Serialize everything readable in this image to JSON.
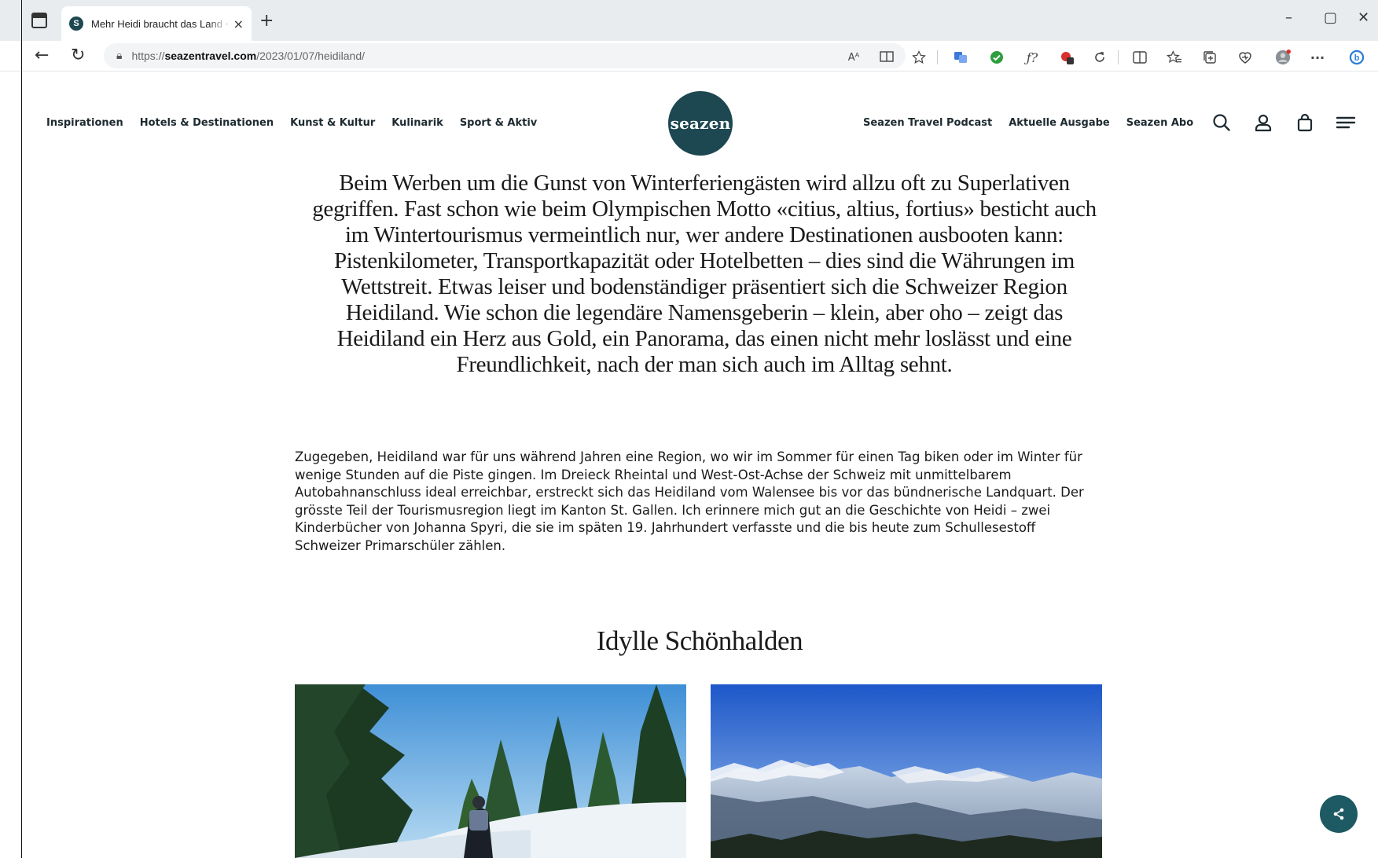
{
  "browser": {
    "tab_title": "Mehr Heidi braucht das Land • se",
    "favicon_letter": "S",
    "url_prefix": "https://",
    "url_host": "seazentravel.com",
    "url_path": "/2023/01/07/heidiland/",
    "icons": [
      "tab-actions-icon",
      "close-icon",
      "new-tab-icon",
      "minimize-icon",
      "maximize-icon",
      "close-window-icon",
      "back-icon",
      "refresh-icon",
      "lock-icon",
      "read-aloud-icon",
      "immersive-reader-icon",
      "favorite-star-icon",
      "extension-icon",
      "split-screen-icon",
      "favorites-icon",
      "collections-icon",
      "profile-icon",
      "more-icon",
      "copilot-icon"
    ],
    "glyphs": {
      "close": "×",
      "new_tab": "+",
      "minimize": "–",
      "maximize": "▢",
      "close_window": "✕",
      "back": "←",
      "refresh": "↻",
      "lock": "🔒",
      "read_aloud": "Aᴬ",
      "more": "···",
      "fx": "ƒ?"
    }
  },
  "site": {
    "logo_text": "seazen",
    "accent_color": "#1d4751",
    "nav_left": [
      "Inspirationen",
      "Hotels & Destinationen",
      "Kunst & Kultur",
      "Kulinarik",
      "Sport & Aktiv"
    ],
    "nav_right": [
      "Seazen Travel Podcast",
      "Aktuelle Ausgabe",
      "Seazen Abo"
    ],
    "nav_icons": [
      "search-icon",
      "account-icon",
      "bag-icon",
      "menu-icon"
    ]
  },
  "article": {
    "lead": "Beim Werben um die Gunst von Winterferiengästen wird allzu oft zu Superlativen gegriffen. Fast schon wie beim Olympischen Motto «citius, altius, fortius» besticht auch im Wintertourismus vermeintlich nur, wer andere Destinationen ausbooten kann: Pistenkilometer, Transportkapazität oder Hotelbetten – dies sind die Währungen im Wettstreit. Etwas leiser und bodenständiger präsentiert sich die Schweizer Region Heidiland. Wie schon die legendäre Namensgeberin – klein, aber oho – zeigt das Heidiland ein Herz aus Gold, ein Panorama, das einen nicht mehr loslässt und eine Freundlichkeit, nach der man sich auch im Alltag sehnt.",
    "body": "Zugegeben, Heidiland war für uns während Jahren eine Region, wo wir im Sommer für einen Tag biken oder im Winter für wenige Stunden auf die Piste gingen. Im Dreieck Rheintal und West-Ost-Achse der Schweiz mit unmittelbarem Autobahnanschluss ideal erreichbar, erstreckt sich das Heidiland vom Walensee bis vor das bündnerische Landquart. Der grösste Teil der Tourismusregion liegt im Kanton St. Gallen. Ich erinnere mich gut an die Geschichte von Heidi – zwei Kinderbücher von Johanna Spyri, die sie im späten 19. Jahrhundert verfasste und die bis heute zum Schullesestoff Schweizer Primarschüler zählen.",
    "section_title": "Idylle Schönhalden"
  }
}
